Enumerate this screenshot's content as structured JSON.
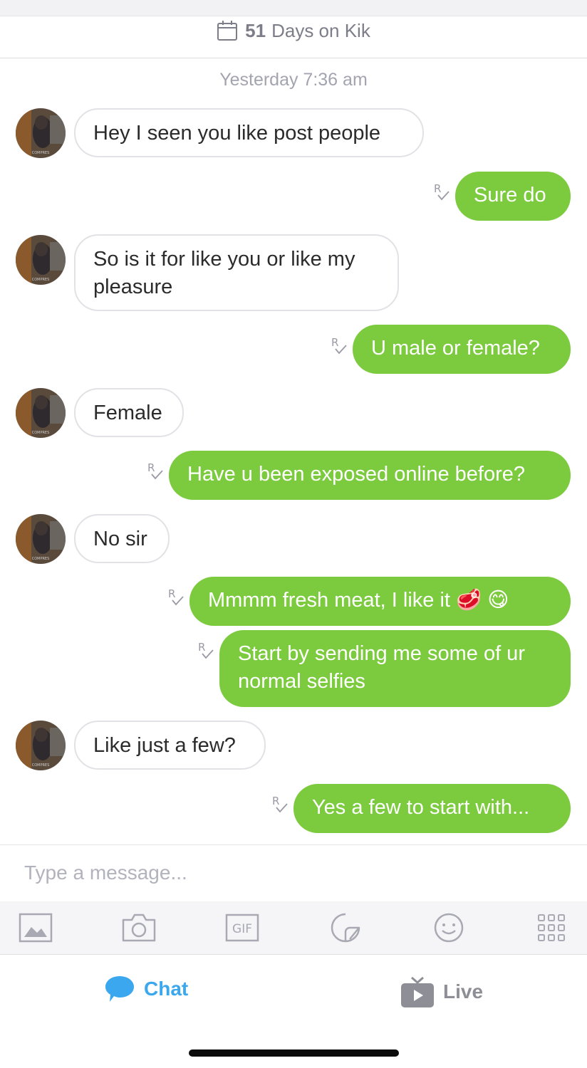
{
  "header": {
    "days_count": "51",
    "days_label": "Days on Kik"
  },
  "timestamp": "Yesterday 7:36 am",
  "messages": [
    {
      "dir": "in",
      "text": "Hey I seen you like post people"
    },
    {
      "dir": "out",
      "text": "Sure do",
      "receipt": "R"
    },
    {
      "dir": "in",
      "text": "So is it for like you or like my pleasure"
    },
    {
      "dir": "out",
      "text": "U male or female?",
      "receipt": "R"
    },
    {
      "dir": "in",
      "text": "Female"
    },
    {
      "dir": "out",
      "text": "Have u been exposed online before?",
      "receipt": "R"
    },
    {
      "dir": "in",
      "text": "No sir"
    },
    {
      "dir": "out",
      "text": "Mmmm fresh meat, I like it 🥩 😋",
      "receipt": "R"
    },
    {
      "dir": "out",
      "text": "Start by sending me some of ur normal selfies",
      "receipt": "R"
    },
    {
      "dir": "in",
      "text": "Like just a few?"
    },
    {
      "dir": "out",
      "text": "Yes a few to start with...",
      "receipt": "R"
    }
  ],
  "composer": {
    "placeholder": "Type a message..."
  },
  "toolbar": {
    "gif_label": "GIF"
  },
  "tabs": {
    "chat_label": "Chat",
    "live_label": "Live"
  },
  "colors": {
    "outgoing_bubble": "#7ccb3e",
    "chat_tab": "#3aa7ef",
    "inactive_tab": "#8e8e96"
  }
}
